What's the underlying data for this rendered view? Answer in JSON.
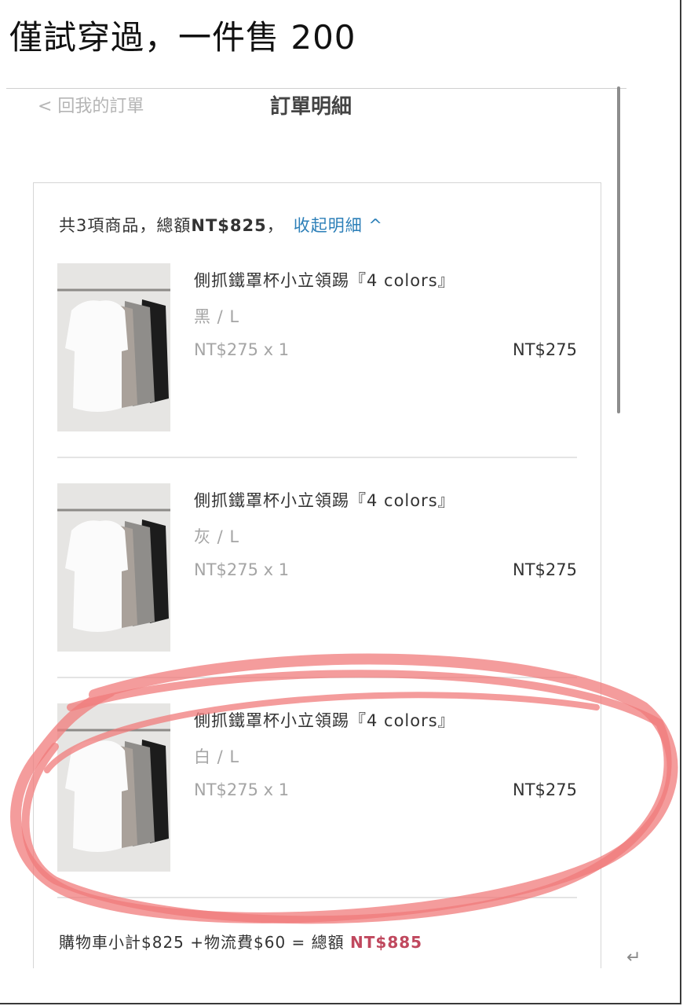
{
  "caption": "僅試穿過，一件售 200",
  "header": {
    "back_label": "< 回我的訂單",
    "title": "訂單明細"
  },
  "order": {
    "summary_prefix": "共3項商品，總額",
    "summary_total": "NT$825",
    "summary_suffix": "，",
    "toggle_label": "收起明細 ^",
    "items": [
      {
        "name": "側抓鐵罩杯小立領踢『4 colors』",
        "variant": "黑 / L",
        "unit": "NT$275 x 1",
        "total": "NT$275"
      },
      {
        "name": "側抓鐵罩杯小立領踢『4 colors』",
        "variant": "灰 / L",
        "unit": "NT$275 x 1",
        "total": "NT$275"
      },
      {
        "name": "側抓鐵罩杯小立領踢『4 colors』",
        "variant": "白 / L",
        "unit": "NT$275 x 1",
        "total": "NT$275"
      }
    ],
    "footer_prefix": "購物車小計$825 +物流費$60 = 總額 ",
    "footer_total": "NT$885"
  },
  "return_glyph": "↵",
  "colors": {
    "link": "#2c7fb8",
    "grand_total": "#c0485e",
    "highlight_ring": "#f07b7b"
  },
  "icons": {
    "product_thumbnail": "shirt-rack-photo",
    "toggle": "chevron-up-icon",
    "back": "chevron-left-icon"
  }
}
